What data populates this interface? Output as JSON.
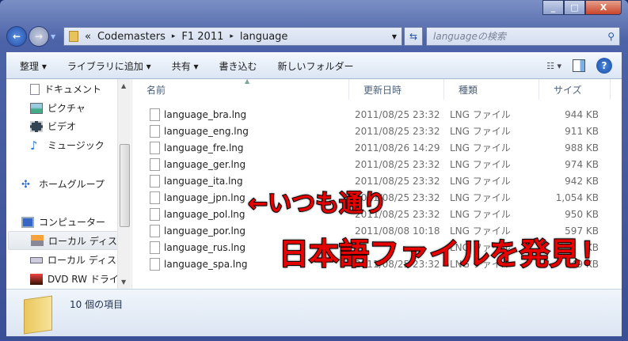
{
  "window": {
    "minimize": "_",
    "maximize": "□",
    "close": "X"
  },
  "address": {
    "overflow": "«",
    "crumbs": [
      "Codemasters",
      "F1 2011",
      "language"
    ],
    "separator": "▸"
  },
  "search": {
    "placeholder": "languageの検索"
  },
  "toolbar": {
    "organize": "整理 ▾",
    "add_library": "ライブラリに追加 ▾",
    "share": "共有 ▾",
    "burn": "書き込む",
    "new_folder": "新しいフォルダー"
  },
  "nav": {
    "items": [
      {
        "label": "ドキュメント",
        "icon": "document-icon"
      },
      {
        "label": "ピクチャ",
        "icon": "picture-icon"
      },
      {
        "label": "ビデオ",
        "icon": "video-icon"
      },
      {
        "label": "ミュージック",
        "icon": "music-icon"
      },
      {
        "label": "ホームグループ",
        "icon": "homegroup-icon"
      },
      {
        "label": "コンピューター",
        "icon": "computer-icon"
      },
      {
        "label": "ローカル ディスク",
        "icon": "local-disk-icon"
      },
      {
        "label": "ローカル ディスク",
        "icon": "local-disk-icon"
      },
      {
        "label": "DVD RW ドライブ",
        "icon": "dvd-drive-icon"
      }
    ]
  },
  "columns": {
    "name": "名前",
    "date": "更新日時",
    "type": "種類",
    "size": "サイズ"
  },
  "files": [
    {
      "name": "language_bra.lng",
      "date": "2011/08/25 23:32",
      "type": "LNG ファイル",
      "size": "944 KB"
    },
    {
      "name": "language_eng.lng",
      "date": "2011/08/25 23:32",
      "type": "LNG ファイル",
      "size": "911 KB"
    },
    {
      "name": "language_fre.lng",
      "date": "2011/08/26 14:29",
      "type": "LNG ファイル",
      "size": "988 KB"
    },
    {
      "name": "language_ger.lng",
      "date": "2011/08/25 23:32",
      "type": "LNG ファイル",
      "size": "974 KB"
    },
    {
      "name": "language_ita.lng",
      "date": "2011/08/25 23:32",
      "type": "LNG ファイル",
      "size": "942 KB"
    },
    {
      "name": "language_jpn.lng",
      "date": "2011/08/25 23:32",
      "type": "LNG ファイル",
      "size": "1,054 KB"
    },
    {
      "name": "language_pol.lng",
      "date": "2011/08/25 23:32",
      "type": "LNG ファイル",
      "size": "950 KB"
    },
    {
      "name": "language_por.lng",
      "date": "2011/08/08 10:18",
      "type": "LNG ファイル",
      "size": "597 KB"
    },
    {
      "name": "language_rus.lng",
      "date": "",
      "type": "LNG ファイル",
      "size": "KB"
    },
    {
      "name": "language_spa.lng",
      "date": "2011/08/25 23:32",
      "type": "LNG ファイル",
      "size": "949 KB"
    }
  ],
  "status": {
    "count": "10 個の項目"
  },
  "annotations": {
    "arrow_note": "←いつも通り",
    "found_note": "日本語ファイルを発見！"
  },
  "colors": {
    "annotation": "#e60000",
    "frame": "#3a4f96"
  }
}
